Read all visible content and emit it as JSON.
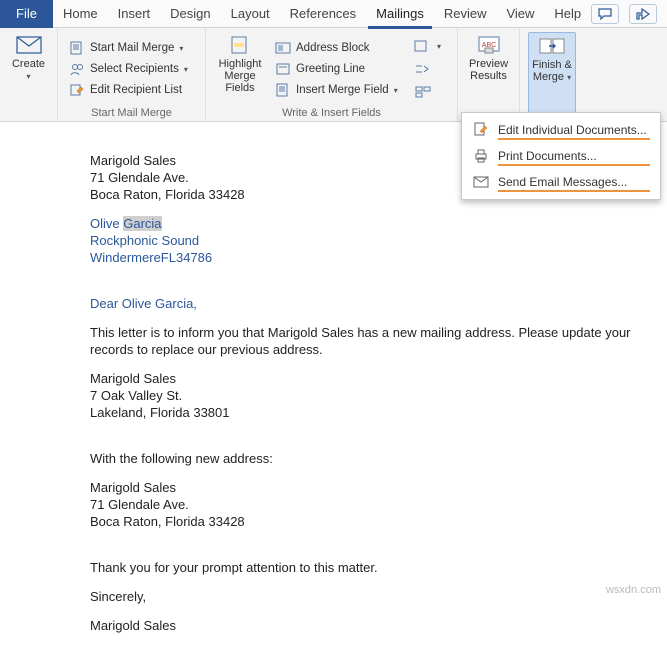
{
  "tabs": {
    "file": "File",
    "list": [
      "Home",
      "Insert",
      "Design",
      "Layout",
      "References",
      "Mailings",
      "Review",
      "View",
      "Help"
    ],
    "active": "Mailings"
  },
  "ribbon": {
    "create": {
      "label": "Create"
    },
    "start_group": {
      "label": "Start Mail Merge",
      "start_mm": "Start Mail Merge",
      "select_rcp": "Select Recipients",
      "edit_rcp": "Edit Recipient List"
    },
    "write_group": {
      "label": "Write & Insert Fields",
      "highlight": "Highlight Merge Fields",
      "address": "Address Block",
      "greeting": "Greeting Line",
      "insert_mf": "Insert Merge Field"
    },
    "preview": {
      "label": "Preview Results"
    },
    "finish": {
      "label": "Finish & Merge"
    }
  },
  "finish_menu": {
    "edit": "Edit Individual Documents...",
    "print": "Print Documents...",
    "email": "Send Email Messages..."
  },
  "doc": {
    "sender_name": "Marigold Sales",
    "sender_addr1": "71 Glendale Ave.",
    "sender_addr2": "Boca Raton, Florida 33428",
    "fn": "Olive",
    "ln": "Garcia",
    "company": "Rockphonic Sound",
    "city_state_zip": "WindermereFL34786",
    "salutation": "Dear Olive Garcia,",
    "body1": "This letter is to inform you that Marigold Sales has a new mailing address. Please update your records to replace our previous address.",
    "old_name": "Marigold Sales",
    "old_addr1": "7 Oak Valley St.",
    "old_addr2": "Lakeland, Florida 33801",
    "body2": "With the following new address:",
    "new_name": "Marigold Sales",
    "new_addr1": "71 Glendale Ave.",
    "new_addr2": "Boca Raton, Florida 33428",
    "body3": "Thank you for your prompt attention to this matter.",
    "closing": "Sincerely,",
    "sig": "Marigold Sales"
  },
  "watermark": "wsxdn.com"
}
